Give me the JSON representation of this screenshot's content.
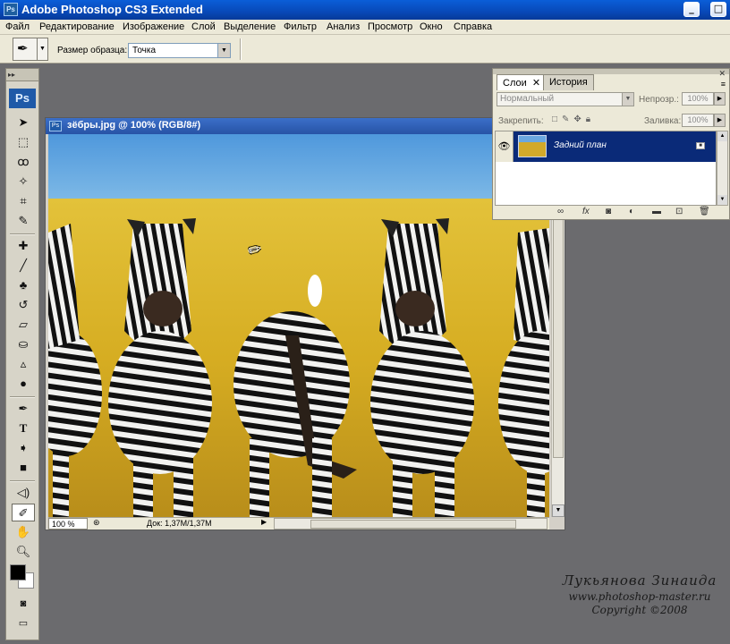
{
  "window": {
    "app_icon": "Ps",
    "title": "Adobe Photoshop CS3 Extended",
    "controls": {
      "minimize": "_",
      "maximize": "□",
      "close": "✕"
    }
  },
  "menu": [
    "Файл",
    "Редактирование",
    "Изображение",
    "Слой",
    "Выделение",
    "Фильтр",
    "Анализ",
    "Просмотр",
    "Окно",
    "Справка"
  ],
  "options": {
    "tool_icon": "eyedropper-icon",
    "sample_size_label": "Размер образца:",
    "sample_size_value": "Точка"
  },
  "toolbox": {
    "logo": "Ps",
    "tools": [
      "move",
      "marquee",
      "lasso",
      "magic-wand",
      "crop",
      "slice",
      "healing",
      "brush",
      "clone-stamp",
      "history-brush",
      "eraser",
      "paint-bucket",
      "blur",
      "dodge",
      "pen",
      "type",
      "path-selection",
      "rectangle",
      "notes",
      "eyedropper",
      "hand",
      "zoom"
    ],
    "active_tool": "eyedropper",
    "foreground_color": "#000000",
    "background_color": "#ffffff"
  },
  "document": {
    "icon": "Ps",
    "title": "зёбры.jpg @ 100% (RGB/8#)",
    "zoom": "100 %",
    "doc_size": "Док: 1,37M/1,37M"
  },
  "layers_panel": {
    "tabs": [
      "Слои",
      "История"
    ],
    "active_tab": "Слои",
    "blend_mode": "Нормальный",
    "opacity_label": "Непрозр.:",
    "opacity_value": "100%",
    "lock_label": "Закрепить:",
    "fill_label": "Заливка:",
    "fill_value": "100%",
    "layers": [
      {
        "name": "Задний план",
        "visible": true,
        "locked": true,
        "selected": true
      }
    ]
  },
  "watermark": {
    "author": "Лукьянова Зинаида",
    "site": "www.photoshop-master.ru",
    "copyright": "Copyright ©2008"
  },
  "colors": {
    "titlebar": "#0a5ed8",
    "workspace": "#6b6b6e",
    "layer_selected": "#0a2a78",
    "sky": "#5ba3e0",
    "grass": "#d8b52a"
  }
}
